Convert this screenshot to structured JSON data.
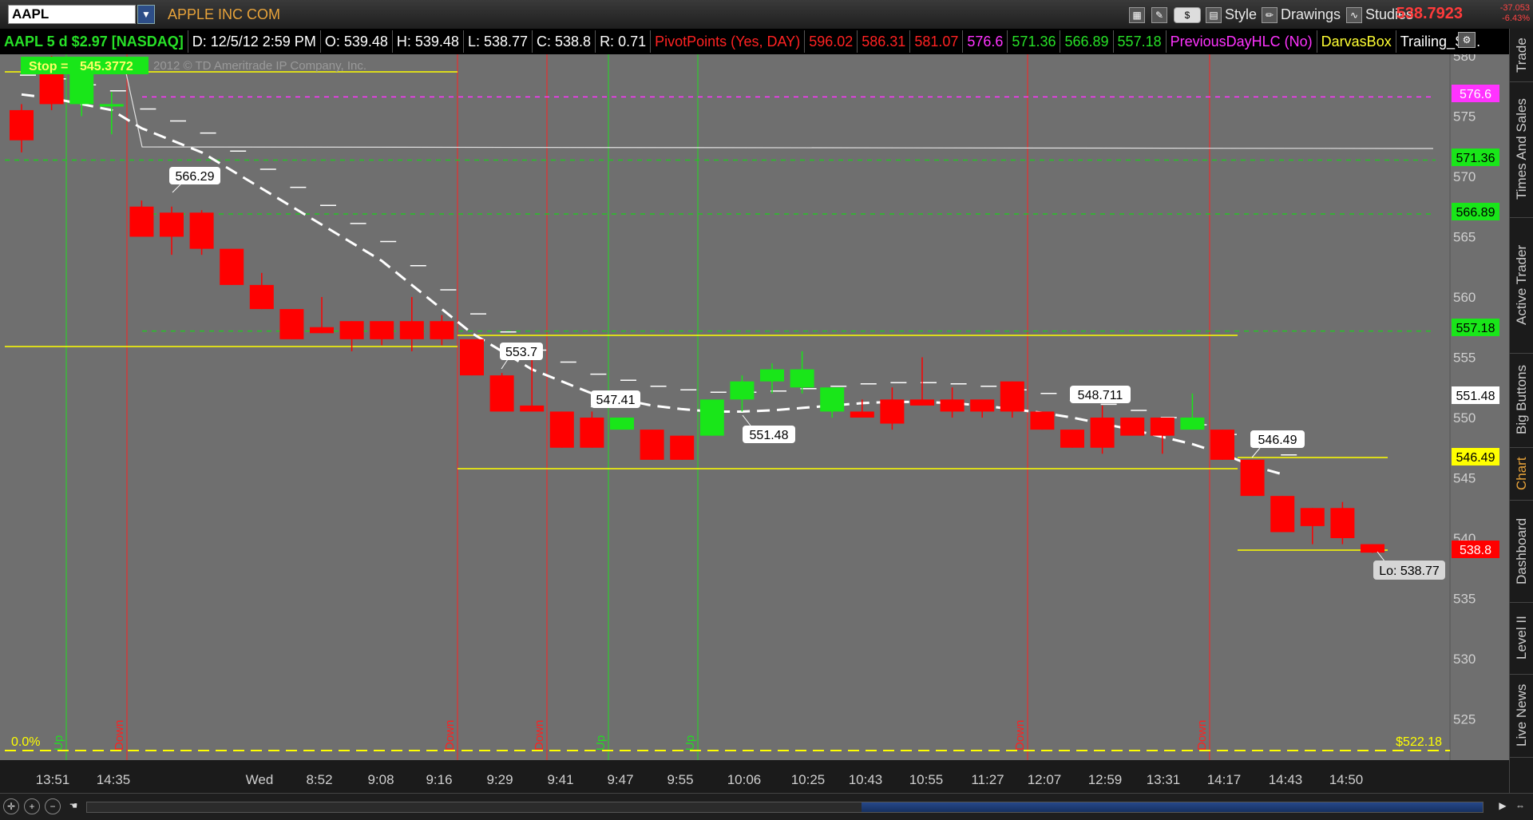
{
  "toolbar": {
    "symbol": "AAPL",
    "company": "APPLE INC COM",
    "dollar_button": "$",
    "style_label": "Style",
    "drawings_label": "Drawings",
    "studies_label": "Studies",
    "last_price": "538.7923",
    "net_change": "-37.053",
    "net_change_pct": "-6.43%"
  },
  "status": {
    "symbol_info": "AAPL 5 d $2.97 [NASDAQ]",
    "date": "D: 12/5/12 2:59 PM",
    "open": "O: 539.48",
    "high": "H: 539.48",
    "low": "L: 538.77",
    "close": "C: 538.8",
    "range": "R: 0.71",
    "pivot_label": "PivotPoints (Yes, DAY)",
    "pivots": [
      "596.02",
      "586.31",
      "581.07",
      "576.6",
      "571.36",
      "566.89",
      "557.18"
    ],
    "prev_day": "PreviousDayHLC (No)",
    "darvas": "DarvasBox",
    "trailing": "Trailing_St..."
  },
  "colors": {
    "background": "#6f6f6f",
    "up_candle": "#19e619",
    "down_candle": "#ff0000",
    "pivot_green": "#27c227",
    "pivot_magenta": "#ff33ff",
    "yellow": "#ffff00",
    "accent_orange": "#e8a33a"
  },
  "chart": {
    "stop_label": "Stop =",
    "stop_value": "545.3772",
    "copyright": "2012 © TD Ameritrade IP Company, Inc.",
    "bottom_pct": "0.0%",
    "bottom_value": "$522.18",
    "lo_label": "Lo: 538.77",
    "price_tags": [
      {
        "text": "576.6",
        "color": "magenta"
      },
      {
        "text": "571.36",
        "color": "green"
      },
      {
        "text": "566.89",
        "color": "green"
      },
      {
        "text": "557.18",
        "color": "green"
      },
      {
        "text": "551.48",
        "color": "white"
      },
      {
        "text": "546.49",
        "color": "yellow"
      },
      {
        "text": "538.8",
        "color": "red"
      }
    ],
    "callouts": [
      "566.29",
      "553.7",
      "547.41",
      "551.48",
      "548.711",
      "546.49"
    ],
    "signals": [
      "Up",
      "Down",
      "Down",
      "Down",
      "Up",
      "Up",
      "Down",
      "Down"
    ]
  },
  "chart_data": {
    "type": "candlestick",
    "y_ticks": [
      580,
      575,
      570,
      565,
      560,
      555,
      550,
      545,
      540,
      535,
      530,
      525
    ],
    "ylim": [
      521,
      581
    ],
    "x_labels": [
      "13:51",
      "14:35",
      "Wed",
      "8:52",
      "9:08",
      "9:16",
      "9:29",
      "9:41",
      "9:47",
      "9:55",
      "10:06",
      "10:25",
      "10:43",
      "10:55",
      "11:27",
      "12:07",
      "12:59",
      "13:31",
      "14:17",
      "14:43",
      "14:50"
    ],
    "candles": [
      {
        "o": 575.5,
        "h": 576.0,
        "l": 572.0,
        "c": 573.0
      },
      {
        "o": 578.5,
        "h": 580.0,
        "l": 575.5,
        "c": 576.0
      },
      {
        "o": 576.0,
        "h": 578.5,
        "l": 575.0,
        "c": 578.5
      },
      {
        "o": 576.0,
        "h": 577.0,
        "l": 573.5,
        "c": 576.0
      },
      {
        "o": 567.5,
        "h": 568.0,
        "l": 565.0,
        "c": 565.0
      },
      {
        "o": 567.0,
        "h": 567.5,
        "l": 563.5,
        "c": 565.0
      },
      {
        "o": 567.0,
        "h": 567.2,
        "l": 563.5,
        "c": 564.0
      },
      {
        "o": 564.0,
        "h": 564.0,
        "l": 561.0,
        "c": 561.0
      },
      {
        "o": 561.0,
        "h": 562.0,
        "l": 559.0,
        "c": 559.0
      },
      {
        "o": 559.0,
        "h": 559.0,
        "l": 556.5,
        "c": 556.5
      },
      {
        "o": 557.5,
        "h": 560.0,
        "l": 557.0,
        "c": 557.0
      },
      {
        "o": 558.0,
        "h": 558.0,
        "l": 555.5,
        "c": 556.5
      },
      {
        "o": 558.0,
        "h": 558.0,
        "l": 556.0,
        "c": 556.5
      },
      {
        "o": 558.0,
        "h": 560.0,
        "l": 555.5,
        "c": 556.5
      },
      {
        "o": 558.0,
        "h": 558.5,
        "l": 556.0,
        "c": 556.5
      },
      {
        "o": 556.5,
        "h": 556.5,
        "l": 553.5,
        "c": 553.5
      },
      {
        "o": 553.5,
        "h": 553.7,
        "l": 550.5,
        "c": 550.5
      },
      {
        "o": 551.0,
        "h": 555.5,
        "l": 550.5,
        "c": 550.5
      },
      {
        "o": 550.5,
        "h": 550.5,
        "l": 547.5,
        "c": 547.5
      },
      {
        "o": 550.0,
        "h": 550.5,
        "l": 547.5,
        "c": 547.5
      },
      {
        "o": 549.0,
        "h": 550.0,
        "l": 549.0,
        "c": 550.0
      },
      {
        "o": 549.0,
        "h": 549.0,
        "l": 546.5,
        "c": 546.5
      },
      {
        "o": 548.5,
        "h": 548.5,
        "l": 546.5,
        "c": 546.5
      },
      {
        "o": 548.5,
        "h": 551.0,
        "l": 548.5,
        "c": 551.5
      },
      {
        "o": 551.5,
        "h": 553.5,
        "l": 550.5,
        "c": 553.0
      },
      {
        "o": 553.0,
        "h": 554.5,
        "l": 552.0,
        "c": 554.0
      },
      {
        "o": 552.5,
        "h": 555.5,
        "l": 552.0,
        "c": 554.0
      },
      {
        "o": 550.5,
        "h": 552.0,
        "l": 550.0,
        "c": 552.5
      },
      {
        "o": 550.5,
        "h": 551.5,
        "l": 550.0,
        "c": 550.0
      },
      {
        "o": 551.5,
        "h": 552.5,
        "l": 549.0,
        "c": 549.5
      },
      {
        "o": 551.5,
        "h": 555.0,
        "l": 551.0,
        "c": 551.0
      },
      {
        "o": 551.5,
        "h": 552.5,
        "l": 550.0,
        "c": 550.5
      },
      {
        "o": 551.5,
        "h": 551.5,
        "l": 550.0,
        "c": 550.5
      },
      {
        "o": 553.0,
        "h": 553.0,
        "l": 550.0,
        "c": 550.5
      },
      {
        "o": 550.5,
        "h": 550.5,
        "l": 549.0,
        "c": 549.0
      },
      {
        "o": 549.0,
        "h": 549.0,
        "l": 547.5,
        "c": 547.5
      },
      {
        "o": 550.0,
        "h": 551.0,
        "l": 547.0,
        "c": 547.5
      },
      {
        "o": 550.0,
        "h": 550.0,
        "l": 548.5,
        "c": 548.5
      },
      {
        "o": 550.0,
        "h": 550.0,
        "l": 547.0,
        "c": 548.5
      },
      {
        "o": 549.0,
        "h": 552.0,
        "l": 549.0,
        "c": 550.0
      },
      {
        "o": 549.0,
        "h": 549.0,
        "l": 546.5,
        "c": 546.5
      },
      {
        "o": 546.5,
        "h": 546.5,
        "l": 543.5,
        "c": 543.5
      },
      {
        "o": 543.5,
        "h": 543.5,
        "l": 540.5,
        "c": 540.5
      },
      {
        "o": 542.5,
        "h": 542.5,
        "l": 539.5,
        "c": 541.0
      },
      {
        "o": 542.5,
        "h": 543.0,
        "l": 539.5,
        "c": 540.0
      },
      {
        "o": 539.5,
        "h": 539.5,
        "l": 538.77,
        "c": 538.8
      }
    ],
    "moving_average": [
      576.8,
      576.5,
      576.0,
      575.5,
      574.0,
      573.0,
      572.0,
      570.5,
      569.0,
      567.5,
      566.0,
      564.5,
      563.0,
      561.0,
      559.0,
      557.0,
      555.5,
      554.0,
      553.0,
      552.0,
      551.5,
      551.0,
      550.7,
      550.5,
      550.5,
      550.6,
      550.8,
      551.0,
      551.2,
      551.3,
      551.3,
      551.2,
      551.0,
      550.7,
      550.4,
      550.0,
      549.5,
      549.0,
      548.4,
      547.8,
      547.0,
      546.0,
      545.3
    ],
    "pivot_levels": [
      {
        "value": 576.6,
        "color": "magenta"
      },
      {
        "value": 571.36,
        "color": "green"
      },
      {
        "value": 566.89,
        "color": "green"
      },
      {
        "value": 557.18,
        "color": "green"
      }
    ]
  },
  "side_tabs": [
    "Trade",
    "Times And Sales",
    "Active Trader",
    "Big Buttons",
    "Chart",
    "Dashboard",
    "Level II",
    "Live News"
  ]
}
